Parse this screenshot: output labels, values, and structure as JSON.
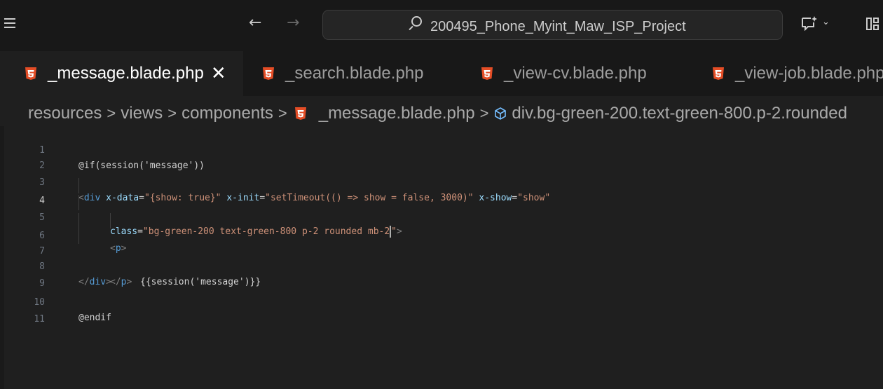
{
  "titlebar": {
    "search_text": "200495_Phone_Myint_Maw_ISP_Project",
    "back_glyph": "←",
    "forward_glyph": "→",
    "chevron": "⌄"
  },
  "tabs": [
    {
      "label": "_message.blade.php",
      "active": true,
      "close": "✕",
      "icon": "html5-icon"
    },
    {
      "label": "_search.blade.php",
      "active": false,
      "icon": "html5-icon"
    },
    {
      "label": "_view-cv.blade.php",
      "active": false,
      "icon": "html5-icon"
    },
    {
      "label": "_view-job.blade.php",
      "active": false,
      "icon": "html5-icon"
    }
  ],
  "breadcrumb": {
    "segments": [
      "resources",
      "views",
      "components",
      "_message.blade.php",
      "div.bg-green-200.text-green-800.p-2.rounded"
    ],
    "separator": ">"
  },
  "editor": {
    "current_line": 4,
    "line_numbers": [
      "1",
      "2",
      "3",
      "4",
      "5",
      "6",
      "7",
      "8",
      "9",
      "10",
      "11"
    ],
    "lines": {
      "l1": "@if(session('message'))",
      "l3_open": "<",
      "l3_tag": "div",
      "l3_attr1": "x-data",
      "l3_eq1": "=",
      "l3_val1": "\"{show: true}\"",
      "l3_attr2": "x-init",
      "l3_eq2": "=",
      "l3_val2": "\"setTimeout(() => show = false, 3000)\"",
      "l3_attr3": "x-show",
      "l3_eq3": "=",
      "l3_val3": "\"show\"",
      "l4_attr": "class",
      "l4_eq": "=",
      "l4_val_a": "\"bg-green-200 text-green-800 p-2 rounded mb-2",
      "l4_val_b": "\"",
      "l4_close": ">",
      "l5_open": "<",
      "l5_tag": "p",
      "l5_close": ">",
      "l6": "{{session('message')}}",
      "l7_open": "</",
      "l7_tag": "p",
      "l7_close": ">",
      "l8_open": "</",
      "l8_tag": "div",
      "l8_close": ">",
      "l10": "@endif"
    }
  },
  "colors": {
    "background": "#1f1f1f",
    "titlebar": "#181818",
    "html5_orange": "#e44d26",
    "tag_blue": "#569cd6",
    "attr_lightblue": "#9cdcfe",
    "string_orange": "#ce9178"
  }
}
